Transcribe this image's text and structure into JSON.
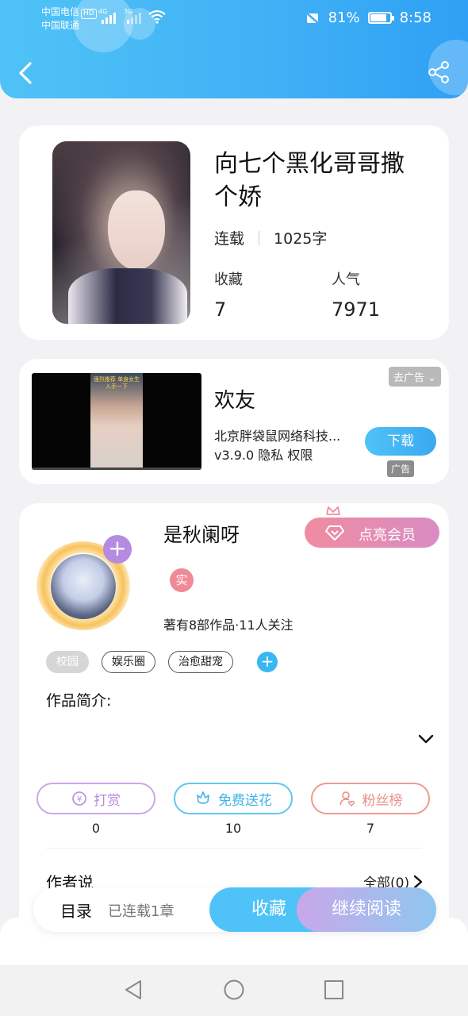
{
  "status_bar": {
    "carrier1": "中国电信",
    "carrier1_hd": "HD",
    "carrier2": "中国联通",
    "net1": "4G",
    "net2": "3G",
    "battery": "81%",
    "time": "8:58"
  },
  "book": {
    "title": "向七个黑化哥哥撒个娇",
    "status": "连载",
    "word_count": "1025字",
    "fav_label": "收藏",
    "fav_value": "7",
    "pop_label": "人气",
    "pop_value": "7971"
  },
  "ad": {
    "title": "欢友",
    "company": "北京胖袋鼠网络科技...",
    "info": "v3.9.0  隐私  权限",
    "close_label": "去广告 ⌄",
    "download_label": "下载",
    "badge": "广告",
    "video_caption": "强烈推荐 单身女生入手一下"
  },
  "author": {
    "name": "是秋阑呀",
    "vip_label": "点亮会员",
    "real_badge": "实",
    "stats": "著有8部作品·11人关注",
    "tags": [
      "校园",
      "娱乐圈",
      "治愈甜宠"
    ],
    "intro_label": "作品简介:",
    "actions": [
      {
        "label": "打赏",
        "count": "0"
      },
      {
        "label": "免费送花",
        "count": "10"
      },
      {
        "label": "粉丝榜",
        "count": "7"
      }
    ],
    "author_says_label": "作者说",
    "all_link": "全部(0)"
  },
  "reader_bar": {
    "toc_label": "目录",
    "progress": "已连载1章",
    "fav_button": "收藏",
    "read_button": "继续阅读"
  },
  "colors": {
    "header": "#3fb0f5",
    "accent_blue": "#4fc3f7",
    "vip_pink": "#f08ca0",
    "tip_purple": "#b48be0",
    "fans_red": "#e98e8a"
  }
}
